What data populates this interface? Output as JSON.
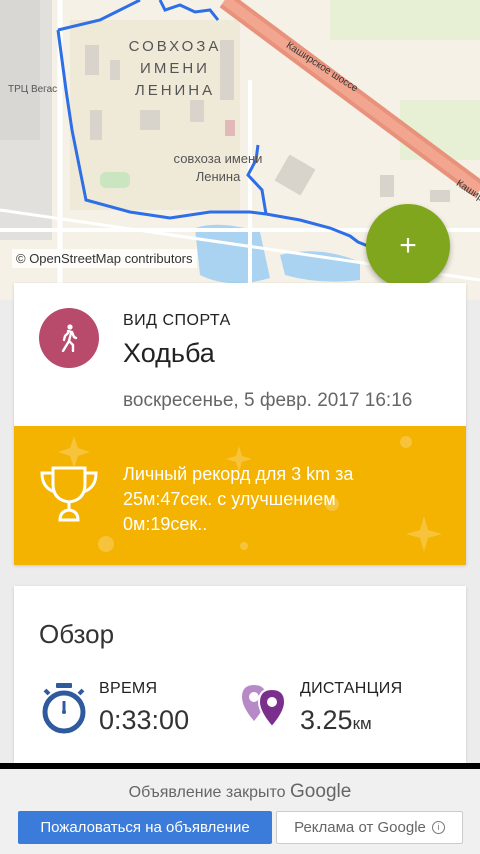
{
  "map": {
    "district_label_line1": "СОВХОЗА",
    "district_label_line2": "ИМЕНИ",
    "district_label_line3": "ЛЕНИНА",
    "settlement_label_line1": "совхоза имени",
    "settlement_label_line2": "Ленина",
    "mall_label": "ТРЦ Вегас",
    "road_label": "Каширское шоссе",
    "road_label_right": "Кашир",
    "attribution": "© OpenStreetMap contributors",
    "add_button_label": "+"
  },
  "activity": {
    "sport_label": "ВИД СПОРТА",
    "sport_name": "Ходьба",
    "date": "воскресенье, 5 февр. 2017 16:16",
    "record_text": "Личный рекорд  для 3 km за 25м:47сек. с улучшением 0м:19сек..",
    "colors": {
      "sport_circle": "#b84a6c",
      "record_bg": "#f4b300",
      "fab": "#7fa61c"
    }
  },
  "overview": {
    "title": "Обзор",
    "time_label": "ВРЕМЯ",
    "time_value": "0:33:00",
    "distance_label": "ДИСТАНЦИЯ",
    "distance_value": "3.25",
    "distance_unit": "км"
  },
  "ad": {
    "closed_text": "Объявление закрыто",
    "closed_brand": "Google",
    "report_button": "Пожаловаться на объявление",
    "ads_by_button": "Реклама от Google",
    "info_icon": "i"
  }
}
